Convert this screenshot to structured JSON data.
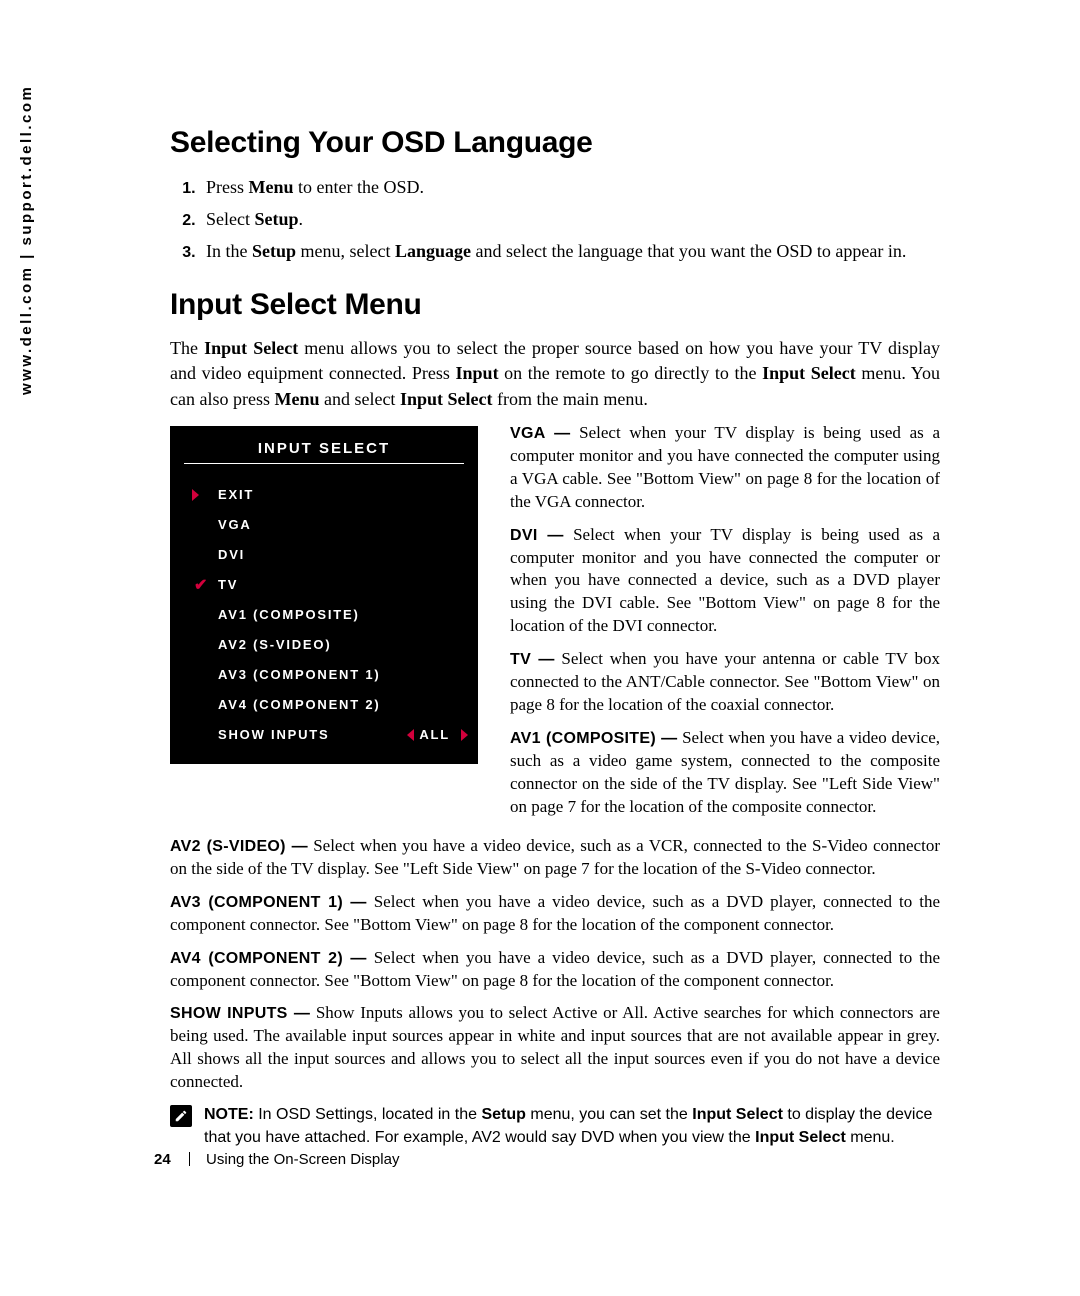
{
  "sidebar_url": "www.dell.com | support.dell.com",
  "heading_osd_lang": "Selecting Your OSD Language",
  "steps": {
    "s1_a": "Press ",
    "s1_b": "Menu",
    "s1_c": " to enter the OSD.",
    "s2_a": "Select ",
    "s2_b": "Setup",
    "s2_c": ".",
    "s3_a": "In the ",
    "s3_b": "Setup",
    "s3_c": " menu, select ",
    "s3_d": "Language",
    "s3_e": " and select the language that you want the OSD to appear in."
  },
  "heading_input_select": "Input Select Menu",
  "intro": {
    "a": "The ",
    "b": "Input Select",
    "c": " menu allows you to select the proper source based on how you have your TV display and video equipment connected. Press ",
    "d": "Input",
    "e": " on the remote to go directly to the ",
    "f": "Input Select",
    "g": " menu. You can also press ",
    "h": "Menu",
    "i": " and select ",
    "j": "Input Select",
    "k": " from the main menu."
  },
  "osd": {
    "title": "INPUT SELECT",
    "items": {
      "exit": "EXIT",
      "vga": "VGA",
      "dvi": "DVI",
      "tv": "TV",
      "av1": "AV1 (COMPOSITE)",
      "av2": "AV2 (S-VIDEO)",
      "av3": "AV3 (COMPONENT 1)",
      "av4": "AV4 (COMPONENT 2)",
      "show": "SHOW INPUTS",
      "show_val": "ALL"
    }
  },
  "defs": {
    "vga": {
      "term": "VGA —",
      "text": " Select when your TV display is being used as a computer monitor and you have connected the computer using a VGA cable. See \"Bottom View\" on page 8 for the location of the VGA connector."
    },
    "dvi": {
      "term": "DVI —",
      "text": " Select when your TV display is being used as a computer monitor and you have connected the computer or when you have connected a device, such as a DVD player using the DVI cable. See \"Bottom View\" on page 8 for the location of the DVI connector."
    },
    "tv": {
      "term": "TV —",
      "text": " Select when you have your antenna or cable TV box connected to the ANT/Cable connector. See \"Bottom View\" on page 8 for the location of the coaxial connector."
    },
    "av1": {
      "term": "AV1 (COMPOSITE) —",
      "text": " Select when you have a video device, such as a video game system, connected to the composite connector on the side of the TV display. See \"Left Side View\" on page 7 for the location of the composite connector."
    },
    "av2": {
      "term": "AV2 (S-VIDEO) —",
      "text": " Select when you have a video device, such as a VCR, connected to the S-Video connector on the side of the TV display. See \"Left Side View\" on page 7 for the location of the S-Video connector."
    },
    "av3": {
      "term": "AV3 (COMPONENT 1) —",
      "text": " Select when you have a video device, such as a DVD player, connected to the component connector. See \"Bottom View\" on page 8 for the location of the component connector."
    },
    "av4": {
      "term": "AV4 (COMPONENT 2) —",
      "text": " Select when you have a video device, such as a DVD player, connected to the component connector. See \"Bottom View\" on page 8 for the location of the component connector."
    },
    "show": {
      "term": "SHOW INPUTS —",
      "text": " Show Inputs allows you to select Active or All. Active searches for which connectors are being used. The available input sources appear in white and input sources that are not available appear in grey. All shows all the input sources and allows you to select all the input sources even if you do not have a device connected."
    }
  },
  "note": {
    "label": "NOTE:",
    "a": " In OSD Settings, located in the ",
    "b": "Setup",
    "c": " menu, you can set the ",
    "d": "Input Select",
    "e": " to display the device that you have attached. For example, AV2 would say DVD when you view the ",
    "f": "Input Select",
    "g": " menu."
  },
  "footer": {
    "page": "24",
    "section": "Using the On-Screen Display"
  }
}
